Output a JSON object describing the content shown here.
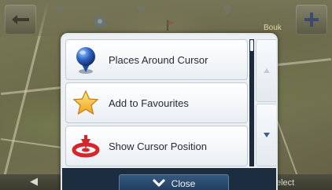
{
  "map": {
    "place_label": "Bouk",
    "bottom_hint": "elect",
    "colors": {
      "terrain": "#6e6b4a",
      "road": "#d7d2b9"
    }
  },
  "menu": {
    "items": [
      {
        "label": "Places Around Cursor",
        "icon": "globe-icon"
      },
      {
        "label": "Add to Favourites",
        "icon": "star-icon"
      },
      {
        "label": "Show Cursor Position",
        "icon": "cursor-position-icon"
      }
    ],
    "scroll_up_icon": "triangle-up-icon",
    "scroll_down_icon": "triangle-down-icon",
    "close_label": "Close",
    "close_icon": "chevron-down-icon",
    "colors": {
      "panel": "#ecf0f3",
      "close_bar": "#1d2d40",
      "accent": "#2b6bbf"
    }
  }
}
